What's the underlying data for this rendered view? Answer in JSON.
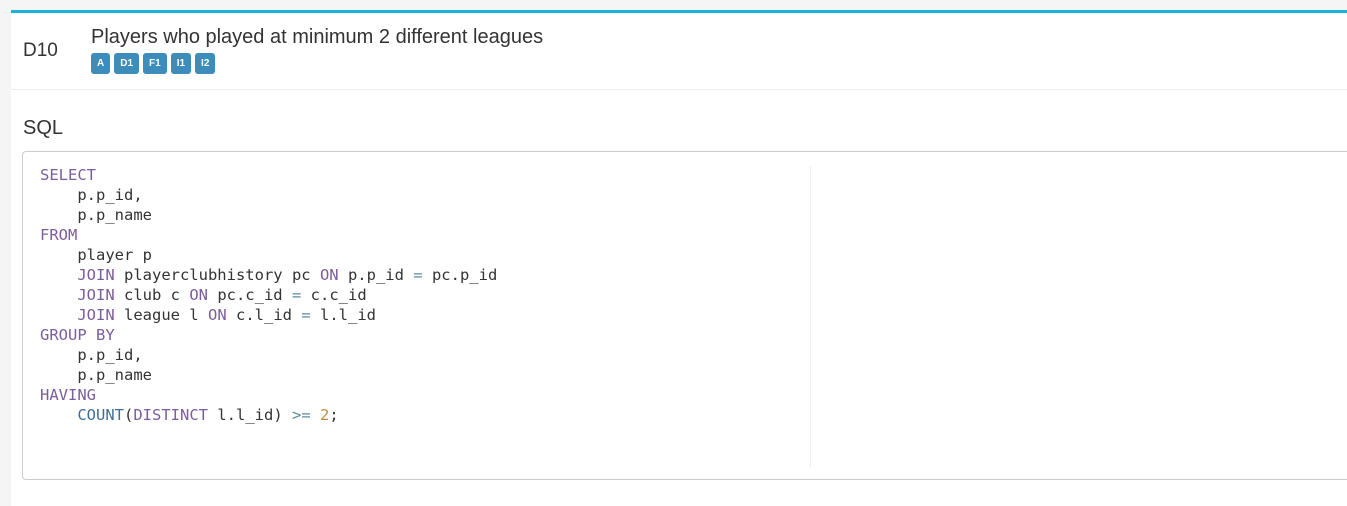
{
  "header": {
    "query_id": "D10",
    "title": "Players who played at minimum 2 different leagues",
    "tags": [
      "A",
      "D1",
      "F1",
      "I1",
      "I2"
    ]
  },
  "section": {
    "label": "SQL"
  },
  "colors": {
    "accent_bar": "#1ab3d8",
    "tag_bg": "#3c8dbc",
    "sql_keyword": "#7c5d9d",
    "sql_function": "#3f6e9a",
    "sql_operator": "#5f8a9c",
    "sql_number": "#c48c3c"
  },
  "sql_lines": [
    [
      {
        "t": "kw",
        "v": "SELECT"
      }
    ],
    [
      {
        "t": "txt",
        "v": "    p.p_id,"
      }
    ],
    [
      {
        "t": "txt",
        "v": "    p.p_name"
      }
    ],
    [
      {
        "t": "kw",
        "v": "FROM"
      }
    ],
    [
      {
        "t": "txt",
        "v": "    player p"
      }
    ],
    [
      {
        "t": "txt",
        "v": "    "
      },
      {
        "t": "kw",
        "v": "JOIN"
      },
      {
        "t": "txt",
        "v": " playerclubhistory pc "
      },
      {
        "t": "kw",
        "v": "ON"
      },
      {
        "t": "txt",
        "v": " p.p_id "
      },
      {
        "t": "op",
        "v": "="
      },
      {
        "t": "txt",
        "v": " pc.p_id"
      }
    ],
    [
      {
        "t": "txt",
        "v": "    "
      },
      {
        "t": "kw",
        "v": "JOIN"
      },
      {
        "t": "txt",
        "v": " club c "
      },
      {
        "t": "kw",
        "v": "ON"
      },
      {
        "t": "txt",
        "v": " pc.c_id "
      },
      {
        "t": "op",
        "v": "="
      },
      {
        "t": "txt",
        "v": " c.c_id"
      }
    ],
    [
      {
        "t": "txt",
        "v": "    "
      },
      {
        "t": "kw",
        "v": "JOIN"
      },
      {
        "t": "txt",
        "v": " league l "
      },
      {
        "t": "kw",
        "v": "ON"
      },
      {
        "t": "txt",
        "v": " c.l_id "
      },
      {
        "t": "op",
        "v": "="
      },
      {
        "t": "txt",
        "v": " l.l_id"
      }
    ],
    [
      {
        "t": "kw",
        "v": "GROUP BY"
      }
    ],
    [
      {
        "t": "txt",
        "v": "    p.p_id,"
      }
    ],
    [
      {
        "t": "txt",
        "v": "    p.p_name"
      }
    ],
    [
      {
        "t": "kw",
        "v": "HAVING"
      }
    ],
    [
      {
        "t": "txt",
        "v": "    "
      },
      {
        "t": "fn",
        "v": "COUNT"
      },
      {
        "t": "txt",
        "v": "("
      },
      {
        "t": "kw",
        "v": "DISTINCT"
      },
      {
        "t": "txt",
        "v": " l.l_id) "
      },
      {
        "t": "op",
        "v": ">="
      },
      {
        "t": "txt",
        "v": " "
      },
      {
        "t": "num",
        "v": "2"
      },
      {
        "t": "txt",
        "v": ";"
      }
    ]
  ]
}
